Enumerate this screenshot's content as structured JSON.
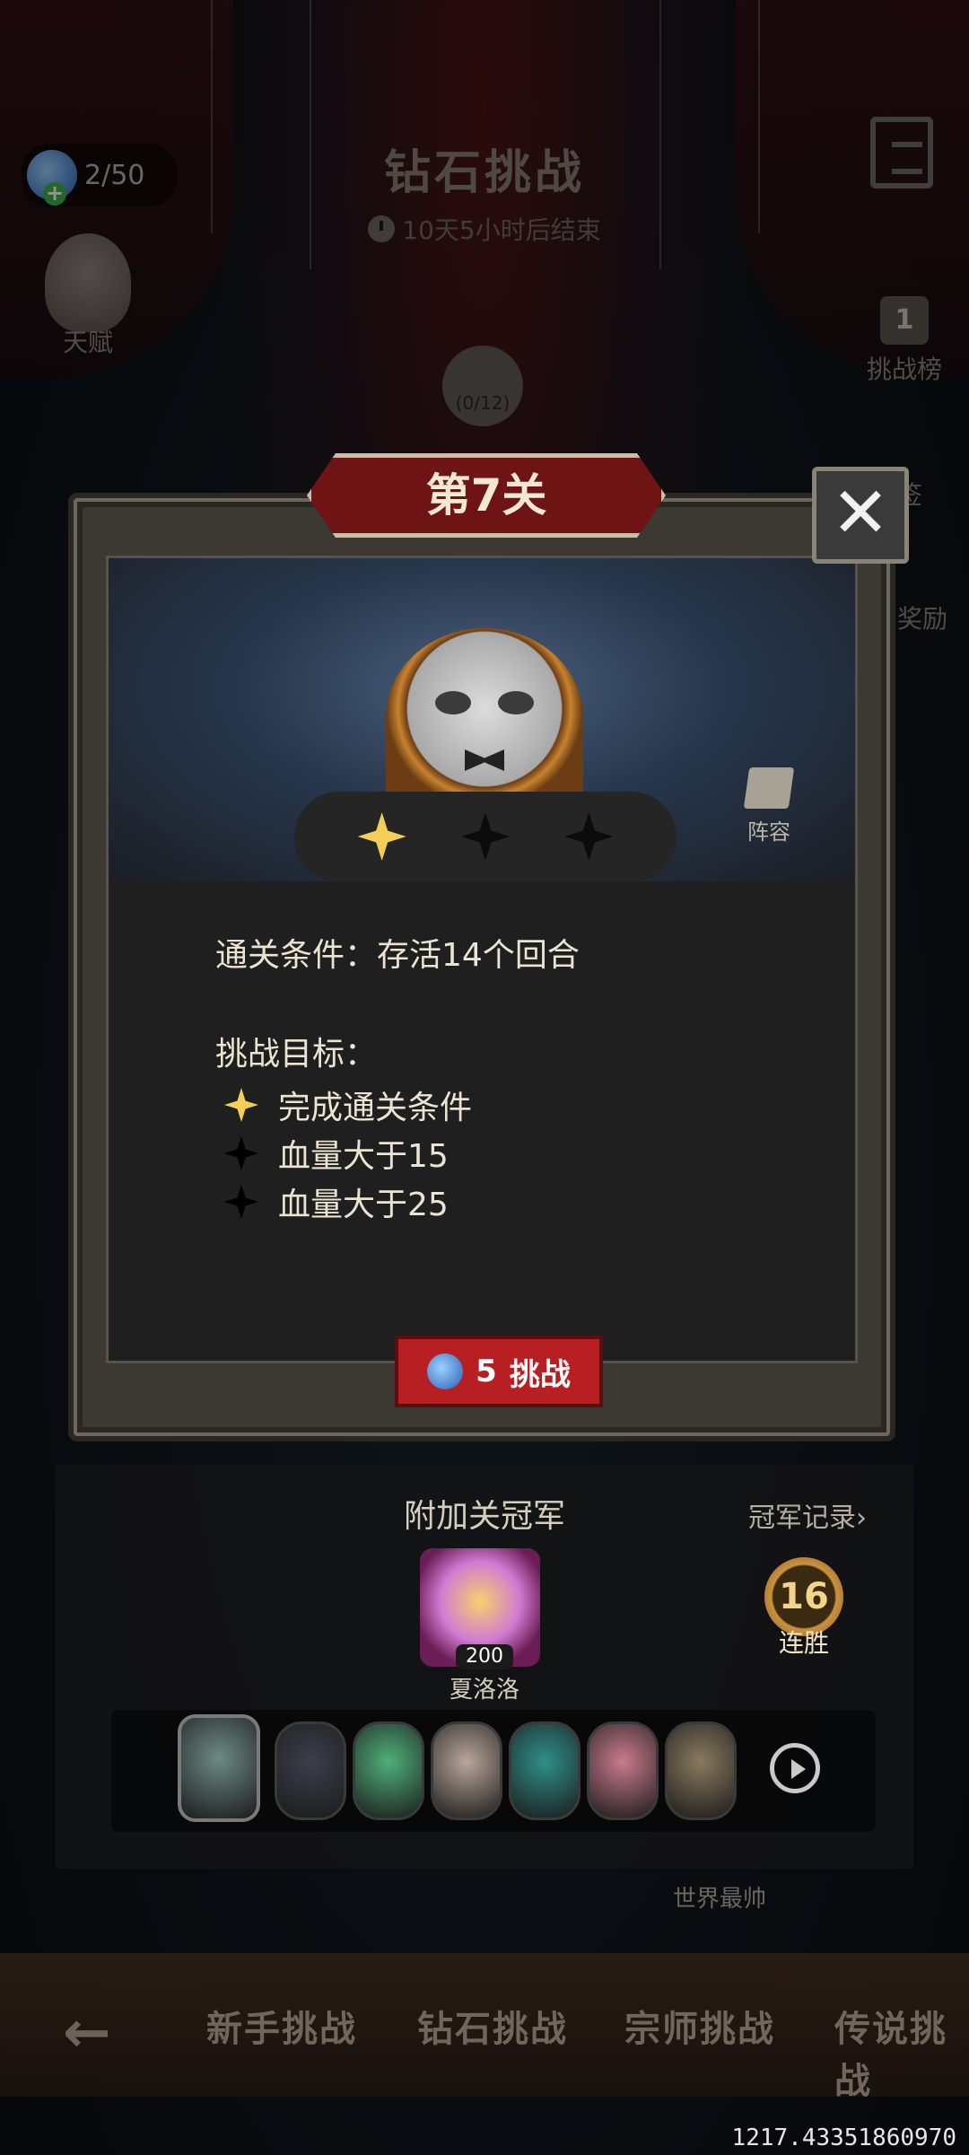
{
  "hud": {
    "energy": "2/50",
    "title": "钻石挑战",
    "timer": "10天5小时后结束",
    "talent_label": "天赋",
    "rank_badge": "1",
    "rank_label": "挑战榜",
    "side_label_1": "签",
    "side_label_2": "奖励",
    "medal_progress": "(0/12)"
  },
  "modal": {
    "stage_title": "第7关",
    "close_glyph": "✕",
    "lineup_label": "阵容",
    "stars_earned": 1,
    "stars_total": 3,
    "condition_label": "通关条件：",
    "condition_value": "存活14个回合",
    "goals_title": "挑战目标：",
    "goals": [
      {
        "text": "完成通关条件",
        "done": true
      },
      {
        "text": "血量大于15",
        "done": false
      },
      {
        "text": "血量大于25",
        "done": false
      }
    ],
    "challenge_cost": "5",
    "challenge_label": "挑战"
  },
  "champion": {
    "title": "附加关冠军",
    "record_link": "冠军记录",
    "name": "夏洛洛",
    "score": "200",
    "streak_count": "16",
    "streak_label": "连胜",
    "team_colors": [
      "#6d8a84",
      "#3b3f4a",
      "#4fb07a",
      "#b9a69a",
      "#2f8f8a",
      "#c87b8e",
      "#8a7a5e"
    ],
    "world_label": "世界最帅"
  },
  "tabs": {
    "items": [
      "新手挑战",
      "钻石挑战",
      "宗师挑战",
      "传说挑战"
    ]
  },
  "footer": {
    "coord": "1217.43351860970"
  }
}
